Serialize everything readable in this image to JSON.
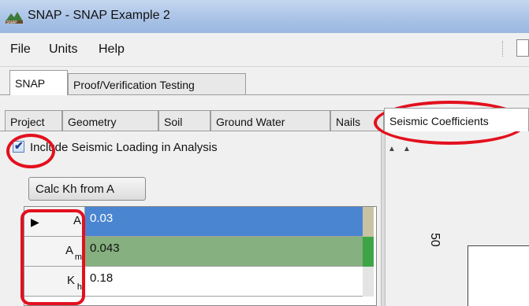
{
  "window": {
    "title": "SNAP - SNAP Example 2"
  },
  "menu": {
    "file": "File",
    "units": "Units",
    "help": "Help"
  },
  "outer_tabs": [
    {
      "label": "SNAP",
      "active": true
    },
    {
      "label": "Proof/Verification Testing",
      "active": false
    }
  ],
  "inner_tabs": [
    {
      "label": "Project"
    },
    {
      "label": "Geometry"
    },
    {
      "label": "Soil"
    },
    {
      "label": "Ground Water"
    },
    {
      "label": "Nails"
    },
    {
      "label": "Seismic Coefficients",
      "active": true
    }
  ],
  "seismic": {
    "include_label": "Include Seismic Loading in Analysis",
    "include_checked": true,
    "checkmark": "✔",
    "calc_button": "Calc Kh from A",
    "rows": [
      {
        "name": "A",
        "sub": "",
        "value": "0.03",
        "color": "#4a85d1"
      },
      {
        "name": "A",
        "sub": "m",
        "value": "0.043",
        "color": "#86b07f"
      },
      {
        "name": "K",
        "sub": "h",
        "value": "0.18",
        "color": "#ffffff"
      }
    ],
    "row_selector": "▶"
  },
  "plot": {
    "y_tick": "50"
  },
  "colors": {
    "annotation": "#e3101e",
    "selected_row": "#4a85d1",
    "computed_row": "#86b07f"
  }
}
